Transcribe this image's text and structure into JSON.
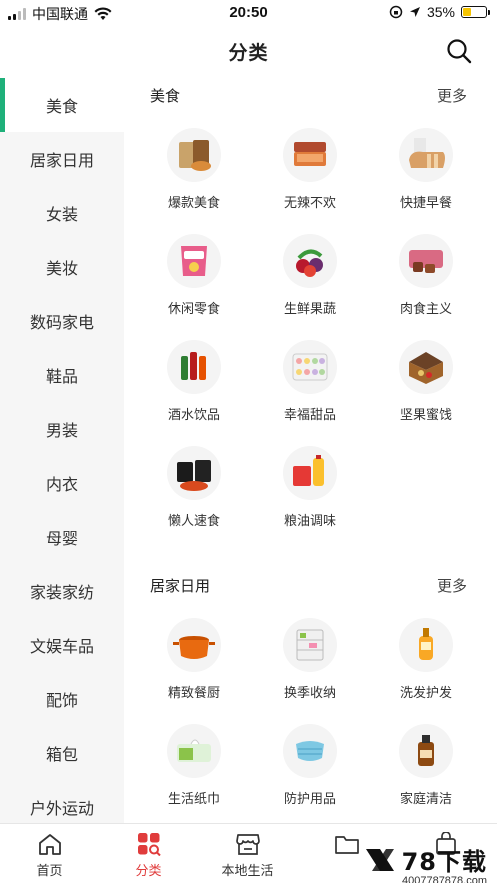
{
  "status_bar": {
    "carrier": "中国联通",
    "time": "20:50",
    "battery_percent": "35%",
    "battery_level": 0.35
  },
  "header": {
    "title": "分类"
  },
  "sidebar": {
    "items": [
      {
        "label": "美食"
      },
      {
        "label": "居家日用"
      },
      {
        "label": "女装"
      },
      {
        "label": "美妆"
      },
      {
        "label": "数码家电"
      },
      {
        "label": "鞋品"
      },
      {
        "label": "男装"
      },
      {
        "label": "内衣"
      },
      {
        "label": "母婴"
      },
      {
        "label": "家装家纺"
      },
      {
        "label": "文娱车品"
      },
      {
        "label": "配饰"
      },
      {
        "label": "箱包"
      },
      {
        "label": "户外运动"
      }
    ]
  },
  "sections": [
    {
      "title": "美食",
      "more": "更多",
      "items": [
        {
          "label": "爆款美食",
          "icon": "snack-bag-icon"
        },
        {
          "label": "无辣不欢",
          "icon": "spicy-meat-icon"
        },
        {
          "label": "快捷早餐",
          "icon": "bread-icon"
        },
        {
          "label": "休闲零食",
          "icon": "chips-icon"
        },
        {
          "label": "生鲜果蔬",
          "icon": "fruit-icon"
        },
        {
          "label": "肉食主义",
          "icon": "meat-icon"
        },
        {
          "label": "酒水饮品",
          "icon": "bottles-icon"
        },
        {
          "label": "幸福甜品",
          "icon": "macaron-icon"
        },
        {
          "label": "坚果蜜饯",
          "icon": "nuts-box-icon"
        },
        {
          "label": "懒人速食",
          "icon": "noodles-icon"
        },
        {
          "label": "粮油调味",
          "icon": "oil-rice-icon"
        }
      ]
    },
    {
      "title": "居家日用",
      "more": "更多",
      "items": [
        {
          "label": "精致餐厨",
          "icon": "pot-icon"
        },
        {
          "label": "换季收纳",
          "icon": "storage-drawer-icon"
        },
        {
          "label": "洗发护发",
          "icon": "shampoo-icon"
        },
        {
          "label": "生活纸巾",
          "icon": "tissue-icon"
        },
        {
          "label": "防护用品",
          "icon": "mask-icon"
        },
        {
          "label": "家庭清洁",
          "icon": "disinfectant-icon"
        }
      ]
    }
  ],
  "tabbar": {
    "tabs": [
      {
        "label": "首页",
        "icon": "home-icon"
      },
      {
        "label": "分类",
        "icon": "category-icon"
      },
      {
        "label": "本地生活",
        "icon": "store-icon"
      },
      {
        "label": "",
        "icon": "folder-icon"
      },
      {
        "label": "",
        "icon": "bag-icon"
      }
    ]
  },
  "watermark": {
    "main": "78下载",
    "sub": "4007787878.com"
  },
  "colors": {
    "accent_green": "#1fb07a",
    "active_tab_red": "#e03c3c"
  }
}
